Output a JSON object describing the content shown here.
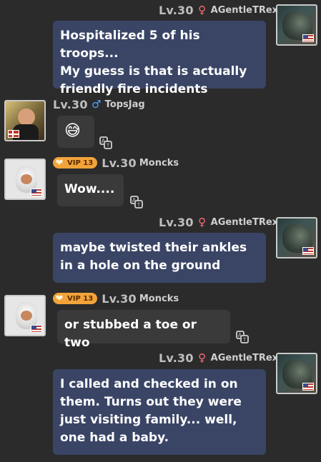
{
  "messages": [
    {
      "level": "Lv.30",
      "gender_icon": "female-symbol-icon",
      "username": "AGentleTRex",
      "text": "Hospitalized 5 of his troops...\nMy guess is that is actually\nfriendly fire incidents",
      "flag": "us-flag-icon"
    },
    {
      "level": "Lv.30",
      "gender_icon": "male-symbol-icon",
      "username": "TopsJag",
      "text": "😅",
      "flag": "denmark-flag-icon"
    },
    {
      "vip_label": "VIP 13",
      "level": "Lv.30",
      "username": "Moncks",
      "text": "Wow....",
      "flag": "us-flag-icon"
    },
    {
      "level": "Lv.30",
      "gender_icon": "female-symbol-icon",
      "username": "AGentleTRex",
      "text": "maybe twisted their ankles\nin a hole on the ground",
      "flag": "us-flag-icon"
    },
    {
      "vip_label": "VIP 13",
      "level": "Lv.30",
      "username": "Moncks",
      "text": "or stubbed a toe or two",
      "flag": "us-flag-icon"
    },
    {
      "level": "Lv.30",
      "gender_icon": "female-symbol-icon",
      "username": "AGentleTRex",
      "text": "I called and checked in on\nthem.  Turns out they were\njust visiting family... well,\none had a baby.",
      "flag": "us-flag-icon"
    }
  ],
  "colors": {
    "background": "#2b2b2b",
    "own_bubble": "#3a4566",
    "other_bubble": "#3a3a3a",
    "vip_badge": "#f2a33a",
    "female_icon": "#ff6b7a",
    "male_icon": "#4aa3ff"
  }
}
